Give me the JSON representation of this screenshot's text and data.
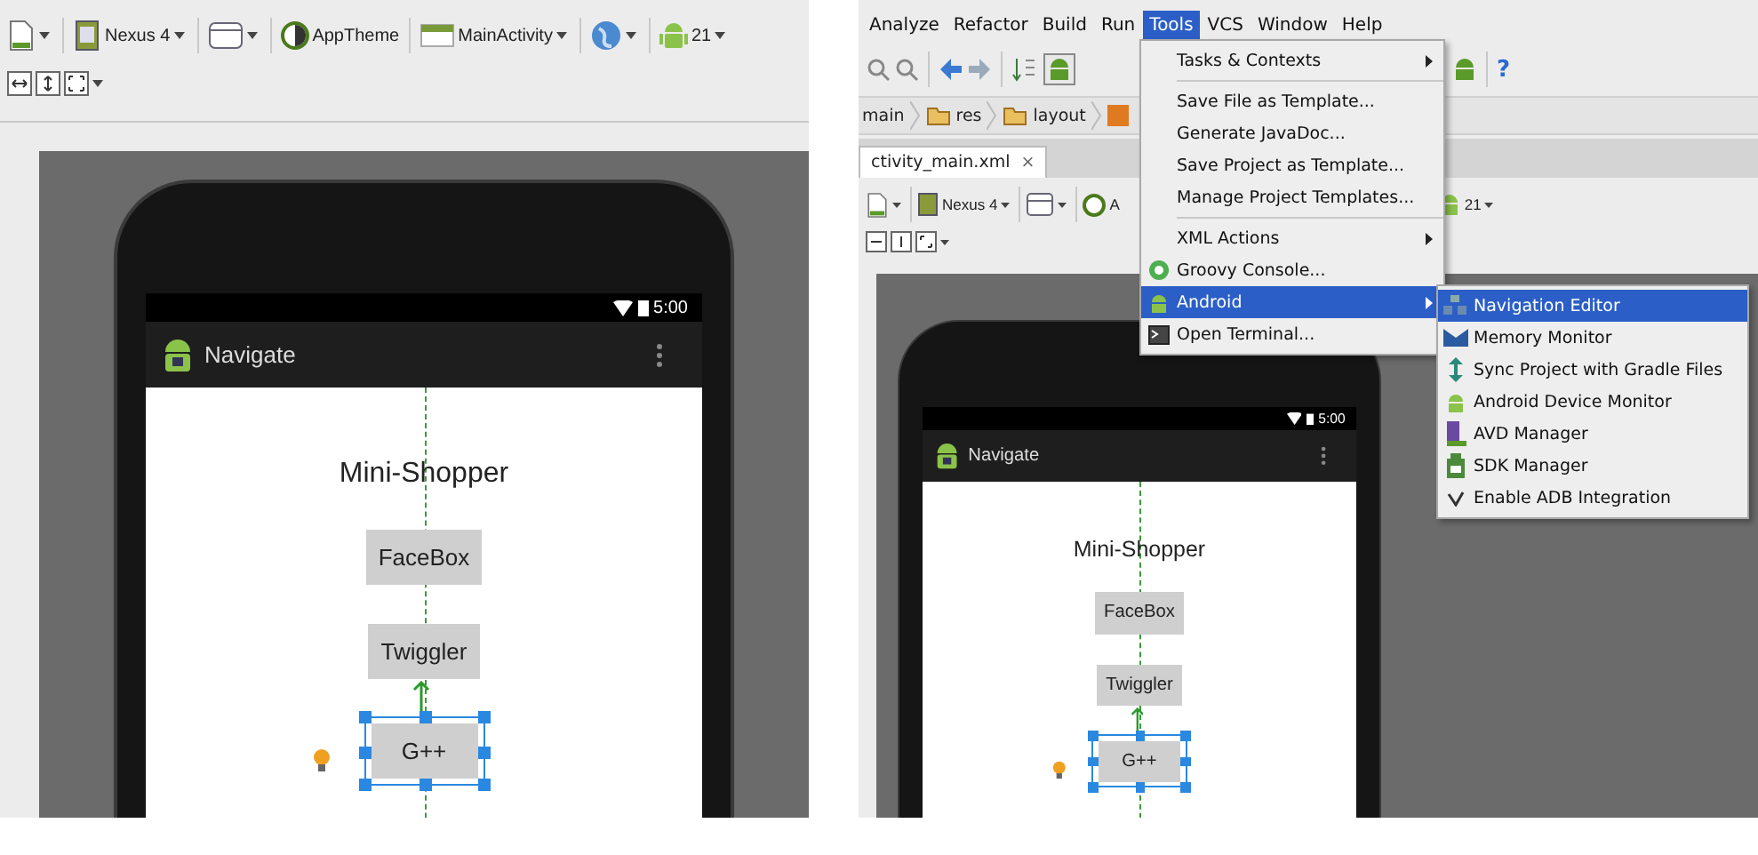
{
  "left_panel": {
    "toolbar": {
      "device": "Nexus 4",
      "theme": "AppTheme",
      "activity": "MainActivity",
      "api": "21"
    },
    "phone": {
      "status_time": "5:00",
      "app_title": "Navigate",
      "heading": "Mini-Shopper",
      "buttons": [
        {
          "label": "FaceBox",
          "selected": false
        },
        {
          "label": "Twiggler",
          "selected": false
        },
        {
          "label": "G++",
          "selected": true
        }
      ]
    }
  },
  "right_panel": {
    "menu_bar": [
      {
        "label": "Analyze",
        "selected": false
      },
      {
        "label": "Refactor",
        "selected": false
      },
      {
        "label": "Build",
        "selected": false
      },
      {
        "label": "Run",
        "selected": false
      },
      {
        "label": "Tools",
        "selected": true
      },
      {
        "label": "VCS",
        "selected": false
      },
      {
        "label": "Window",
        "selected": false
      },
      {
        "label": "Help",
        "selected": false
      }
    ],
    "help_label": "?",
    "breadcrumbs": [
      "main",
      "res",
      "layout"
    ],
    "editor_tab": {
      "label": "ctivity_main.xml",
      "close": "×"
    },
    "toolbar": {
      "device": "Nexus 4",
      "theme": "A",
      "api": "21"
    },
    "tools_menu": [
      {
        "kind": "submenu",
        "label": "Tasks & Contexts",
        "selected": false
      },
      {
        "kind": "separator"
      },
      {
        "kind": "action",
        "label": "Save File as Template...",
        "selected": false
      },
      {
        "kind": "action",
        "label": "Generate JavaDoc...",
        "selected": false
      },
      {
        "kind": "action",
        "label": "Save Project as Template...",
        "selected": false
      },
      {
        "kind": "action",
        "label": "Manage Project Templates...",
        "selected": false
      },
      {
        "kind": "separator"
      },
      {
        "kind": "submenu",
        "label": "XML Actions",
        "selected": false
      },
      {
        "kind": "action",
        "label": "Groovy Console...",
        "selected": false
      },
      {
        "kind": "submenu",
        "label": "Android",
        "selected": true
      },
      {
        "kind": "action",
        "label": "Open Terminal...",
        "selected": false
      }
    ],
    "android_menu": [
      {
        "label": "Navigation Editor",
        "selected": true,
        "checked": false
      },
      {
        "label": "Memory Monitor",
        "selected": false,
        "checked": false
      },
      {
        "label": "Sync Project with Gradle Files",
        "selected": false,
        "checked": false
      },
      {
        "label": "Android Device Monitor",
        "selected": false,
        "checked": false
      },
      {
        "label": "AVD Manager",
        "selected": false,
        "checked": false
      },
      {
        "label": "SDK Manager",
        "selected": false,
        "checked": false
      },
      {
        "label": "Enable ADB Integration",
        "selected": false,
        "checked": true
      }
    ],
    "phone": {
      "status_time": "5:00",
      "app_title": "Navigate",
      "heading": "Mini-Shopper",
      "buttons": [
        {
          "label": "FaceBox",
          "selected": false
        },
        {
          "label": "Twiggler",
          "selected": false
        },
        {
          "label": "G++",
          "selected": true
        }
      ]
    }
  }
}
